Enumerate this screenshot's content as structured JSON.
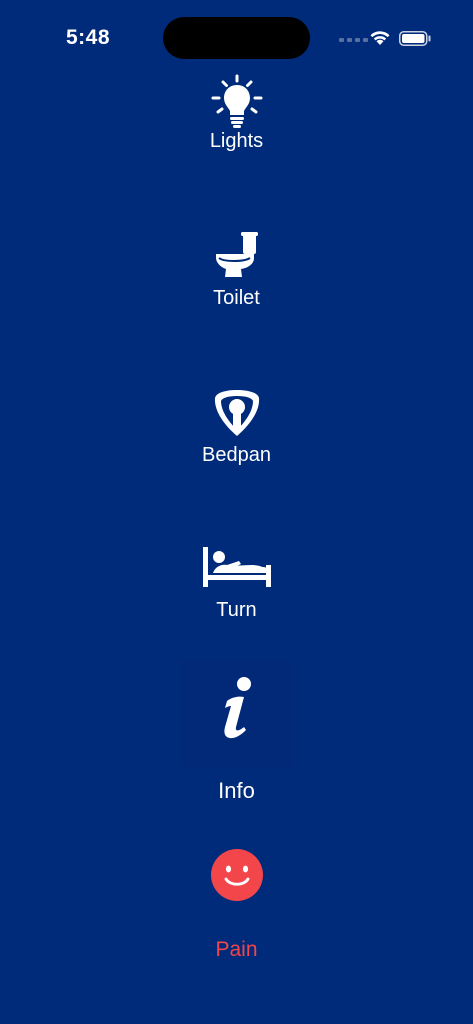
{
  "status_bar": {
    "time": "5:48"
  },
  "actions": [
    {
      "id": "lights",
      "label": "Lights",
      "icon": "lightbulb-icon"
    },
    {
      "id": "toilet",
      "label": "Toilet",
      "icon": "toilet-icon"
    },
    {
      "id": "bedpan",
      "label": "Bedpan",
      "icon": "bedpan-icon"
    },
    {
      "id": "turn",
      "label": "Turn",
      "icon": "bed-person-icon"
    },
    {
      "id": "info",
      "label": "Info",
      "icon": "info-icon"
    },
    {
      "id": "pain",
      "label": "Pain",
      "icon": "smiley-face-icon"
    }
  ],
  "colors": {
    "background": "#002b7a",
    "text": "#ffffff",
    "pain_accent": "#f2464a",
    "info_tile": "#022878"
  }
}
